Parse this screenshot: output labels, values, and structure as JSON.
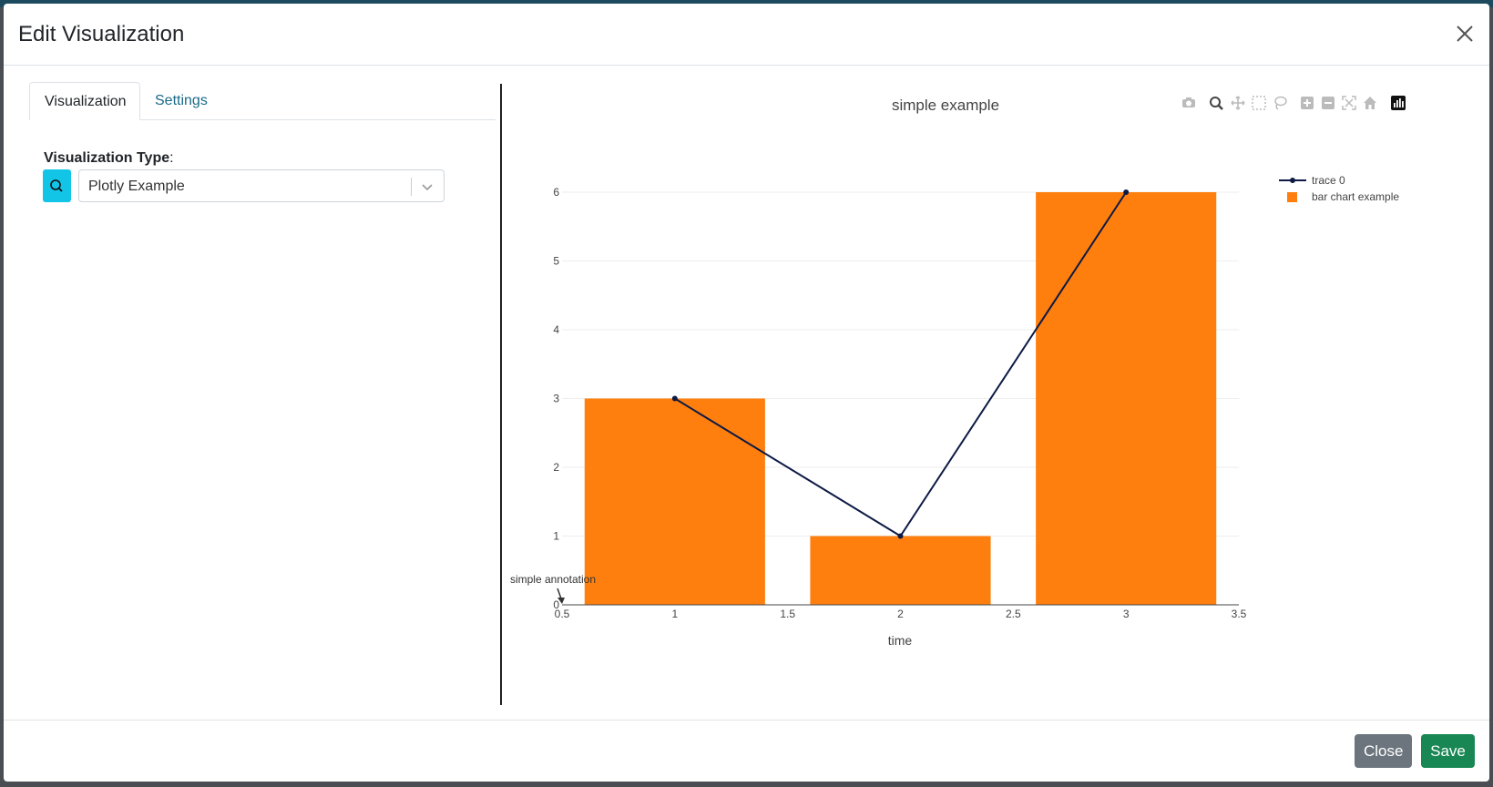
{
  "modal": {
    "title": "Edit Visualization",
    "close_icon": "close-icon"
  },
  "tabs": [
    {
      "label": "Visualization",
      "active": true
    },
    {
      "label": "Settings",
      "active": false
    }
  ],
  "form": {
    "type_label": "Visualization Type",
    "type_colon": ":",
    "selected_value": "Plotly Example",
    "search_icon": "search-icon",
    "dropdown_icon": "chevron-down-icon"
  },
  "toolbar": {
    "icons": [
      "camera-icon",
      "zoom-icon",
      "pan-icon",
      "box-select-icon",
      "lasso-select-icon",
      "zoom-in-icon",
      "zoom-out-icon",
      "autoscale-icon",
      "home-icon",
      "plotly-logo-icon"
    ]
  },
  "chart_data": {
    "type": "bar",
    "title": "simple example",
    "xlabel": "time",
    "ylabel": "",
    "xlim": [
      0.5,
      3.5
    ],
    "ylim": [
      0,
      6
    ],
    "x_ticks": [
      "0.5",
      "1",
      "1.5",
      "2",
      "2.5",
      "3",
      "3.5"
    ],
    "y_ticks": [
      "0",
      "1",
      "2",
      "3",
      "4",
      "5",
      "6"
    ],
    "grid": true,
    "legend_position": "top-right",
    "series": [
      {
        "name": "trace 0",
        "type": "line+markers",
        "x": [
          1,
          2,
          3
        ],
        "y": [
          3,
          1,
          6
        ],
        "color": "#0d1a45"
      },
      {
        "name": "bar chart example",
        "type": "bar",
        "x": [
          1,
          2,
          3
        ],
        "y": [
          3,
          1,
          6
        ],
        "color": "#ff7f0e"
      }
    ],
    "annotation": {
      "text": "simple annotation",
      "x": 0.5,
      "y": 0
    }
  },
  "footer": {
    "close_label": "Close",
    "save_label": "Save"
  },
  "colors": {
    "accent": "#12c4e6",
    "save": "#198754",
    "close": "#6c757d",
    "link": "#1a6a8a"
  }
}
